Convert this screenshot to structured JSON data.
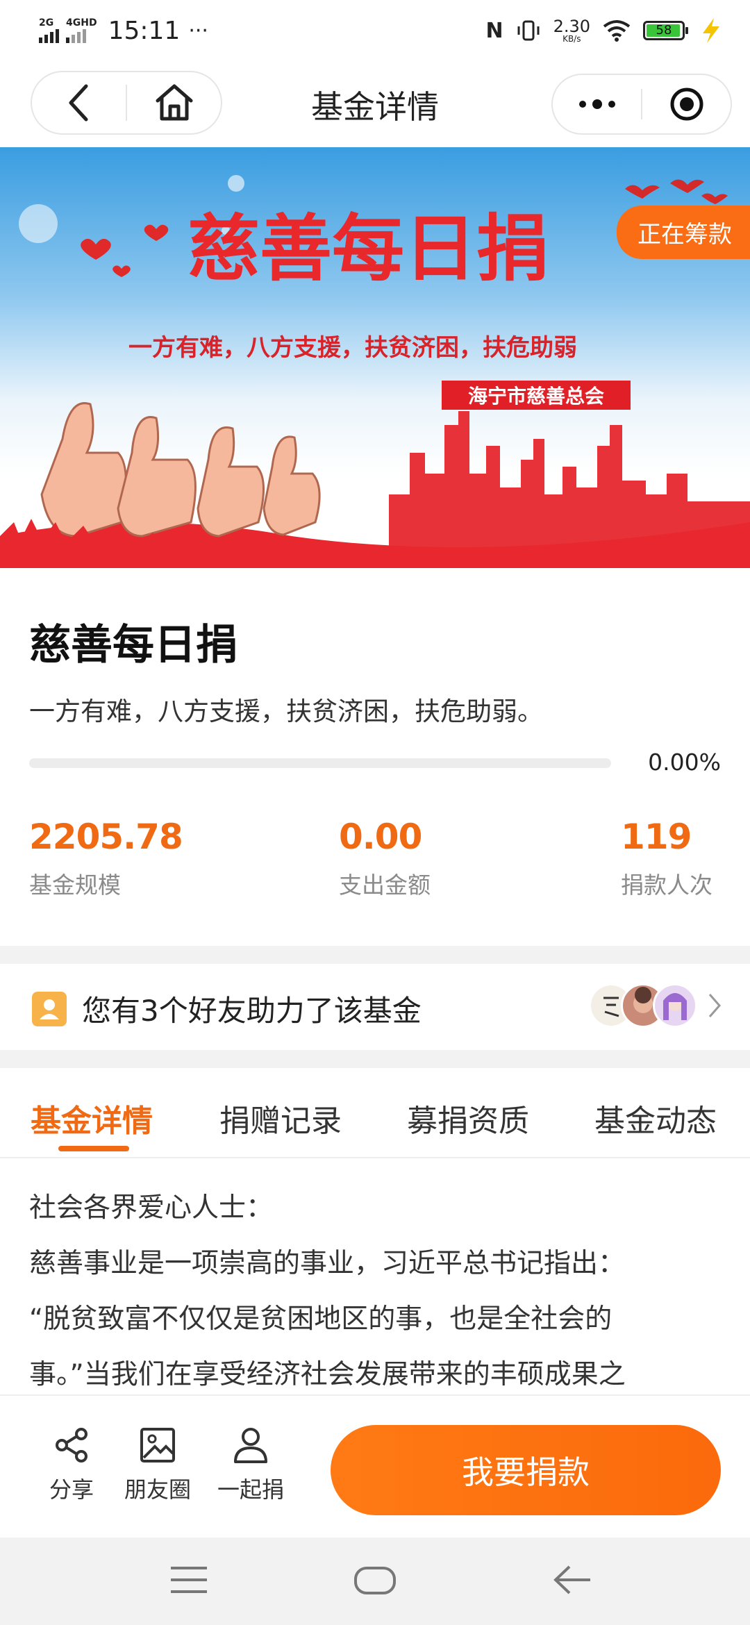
{
  "status_bar": {
    "network1": "2G",
    "network2": "4GHD",
    "time": "15:11",
    "more": "···",
    "nfc": "N",
    "speed_value": "2.30",
    "speed_unit": "KB/s",
    "battery": "58"
  },
  "nav": {
    "title": "基金详情"
  },
  "banner": {
    "headline": "慈善每日捐",
    "slogan": "一方有难，八方支援，扶贫济困，扶危助弱",
    "org": "海宁市慈善总会",
    "badge": "正在筹款"
  },
  "fund": {
    "title": "慈善每日捐",
    "description": "一方有难，八方支援，扶贫济困，扶危助弱。",
    "progress_text": "0.00%",
    "progress_fraction": 0.0,
    "stats": [
      {
        "value": "2205.78",
        "label": "基金规模"
      },
      {
        "value": "0.00",
        "label": "支出金额"
      },
      {
        "value": "119",
        "label": "捐款人次"
      }
    ]
  },
  "friends": {
    "text": "您有3个好友助力了该基金"
  },
  "tabs": [
    "基金详情",
    "捐赠记录",
    "募捐资质",
    "基金动态"
  ],
  "content": {
    "lines": [
      "社会各界爱心人士：",
      "慈善事业是一项崇高的事业，习近平总书记指出：",
      "“脱贫致富不仅仅是贫困地区的事，也是全社会的",
      "事。”当我们在享受经济社会发展带来的丰硕成果之"
    ]
  },
  "actions": {
    "share": "分享",
    "moments": "朋友圈",
    "together": "一起捐",
    "donate": "我要捐款"
  },
  "colors": {
    "accent": "#fa6d14",
    "stat": "#f06a14",
    "banner_red": "#e8232a"
  }
}
